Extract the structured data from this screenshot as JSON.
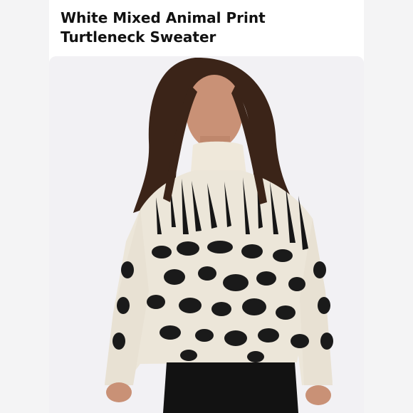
{
  "listing": {
    "title_line1": "White Mixed Animal Print",
    "title_line2": "Turtleneck Sweater"
  },
  "product_image": {
    "subject": "model-wearing-animal-print-turtleneck-sweater",
    "colors": {
      "backdrop": "#f2f1f4",
      "sweater": "#ece6d9",
      "print": "#161616",
      "hair": "#3b2418",
      "skin": "#c99176",
      "pants": "#121212"
    }
  }
}
